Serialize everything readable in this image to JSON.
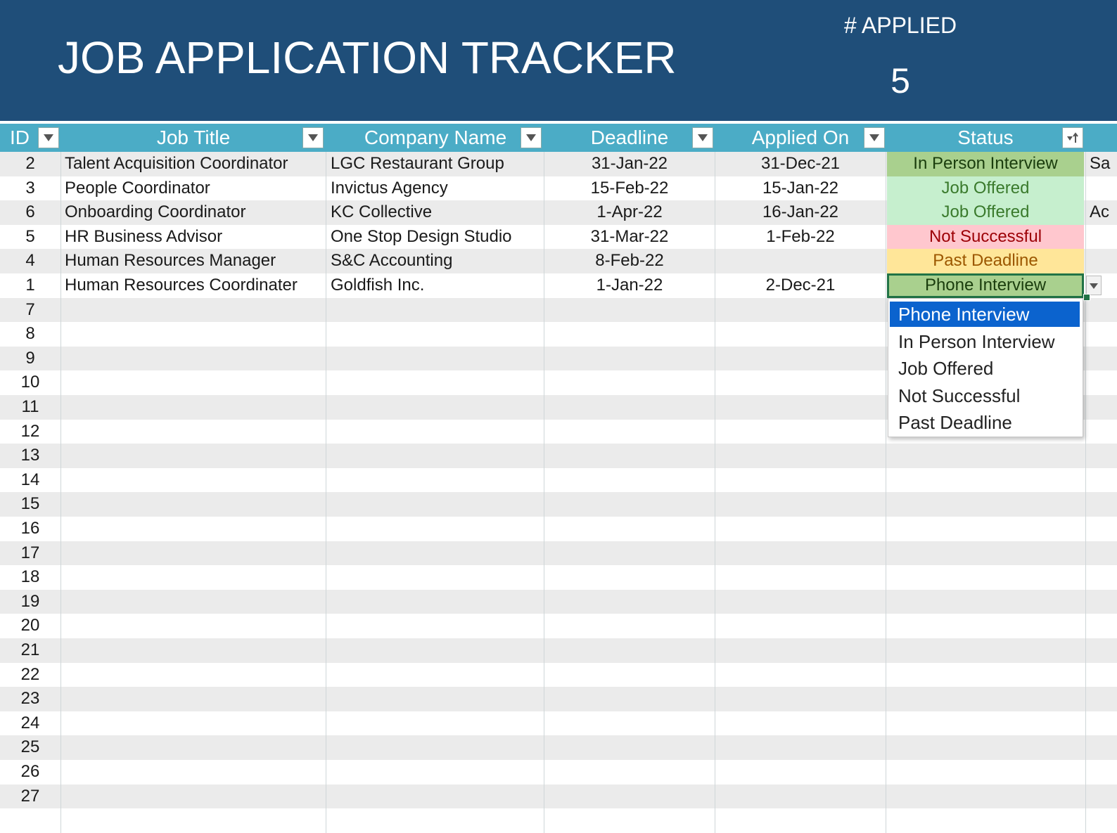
{
  "header": {
    "title": "JOB APPLICATION TRACKER",
    "applied_label": "# APPLIED",
    "applied_count": "5"
  },
  "columns": [
    {
      "key": "id",
      "label": "ID"
    },
    {
      "key": "job_title",
      "label": "Job Title"
    },
    {
      "key": "company",
      "label": "Company Name"
    },
    {
      "key": "deadline",
      "label": "Deadline"
    },
    {
      "key": "applied_on",
      "label": "Applied On"
    },
    {
      "key": "status",
      "label": "Status"
    }
  ],
  "rows": [
    {
      "id": "2",
      "job_title": "Talent Acquisition Coordinator",
      "company": "LGC Restaurant Group",
      "deadline": "31-Jan-22",
      "applied_on": "31-Dec-21",
      "status": "In Person Interview",
      "extra": "Sa"
    },
    {
      "id": "3",
      "job_title": "People Coordinator",
      "company": "Invictus Agency",
      "deadline": "15-Feb-22",
      "applied_on": "15-Jan-22",
      "status": "Job Offered",
      "extra": ""
    },
    {
      "id": "6",
      "job_title": "Onboarding Coordinator",
      "company": "KC Collective",
      "deadline": "1-Apr-22",
      "applied_on": "16-Jan-22",
      "status": "Job Offered",
      "extra": "Ac"
    },
    {
      "id": "5",
      "job_title": "HR Business Advisor",
      "company": "One Stop Design Studio",
      "deadline": "31-Mar-22",
      "applied_on": "1-Feb-22",
      "status": "Not Successful",
      "extra": ""
    },
    {
      "id": "4",
      "job_title": "Human Resources Manager",
      "company": "S&C Accounting",
      "deadline": "8-Feb-22",
      "applied_on": "",
      "status": "Past Deadline",
      "extra": ""
    },
    {
      "id": "1",
      "job_title": "Human Resources Coordinater",
      "company": "Goldfish Inc.",
      "deadline": "1-Jan-22",
      "applied_on": "2-Dec-21",
      "status": "Phone Interview",
      "extra": ""
    }
  ],
  "empty_row_ids": [
    "7",
    "8",
    "9",
    "10",
    "11",
    "12",
    "13",
    "14",
    "15",
    "16",
    "17",
    "18",
    "19",
    "20",
    "21",
    "22",
    "23",
    "24",
    "25",
    "26",
    "27"
  ],
  "status_dropdown": {
    "options": [
      "Phone Interview",
      "In Person Interview",
      "Job Offered",
      "Not Successful",
      "Past Deadline"
    ],
    "highlighted": "Phone Interview"
  },
  "colors": {
    "header_bg": "#1f4e79",
    "column_header_bg": "#4bacc6",
    "selection_blue": "#0b63ce",
    "cell_selection": "#217346"
  }
}
